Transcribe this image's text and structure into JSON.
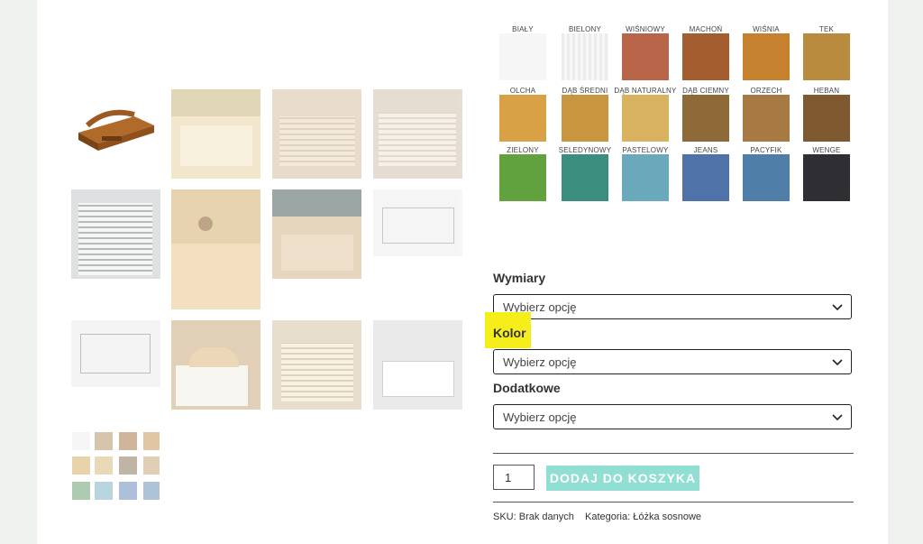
{
  "swatches": [
    {
      "label": "BIAŁY",
      "color": "#f4f4f4"
    },
    {
      "label": "BIELONY",
      "color": "#ebeceb"
    },
    {
      "label": "WIŚNIOWY",
      "color": "#b8654a"
    },
    {
      "label": "MACHOŃ",
      "color": "#a45d2e"
    },
    {
      "label": "WIŚNIA",
      "color": "#c6812e"
    },
    {
      "label": "TEK",
      "color": "#b88b3f"
    },
    {
      "label": "OLCHA",
      "color": "#d9a146"
    },
    {
      "label": "DĄB ŚREDNI",
      "color": "#c7963f"
    },
    {
      "label": "DĄB NATURALNY",
      "color": "#d8b25e"
    },
    {
      "label": "DĄB CIEMNY",
      "color": "#8f6a39"
    },
    {
      "label": "ORZECH",
      "color": "#a77a44"
    },
    {
      "label": "HEBAN",
      "color": "#7f5a31"
    },
    {
      "label": "ZIELONY",
      "color": "#62a23e"
    },
    {
      "label": "SELEDYNOWY",
      "color": "#3b8e7e"
    },
    {
      "label": "PASTELOWY",
      "color": "#6aa9bb"
    },
    {
      "label": "JEANS",
      "color": "#4f72a8"
    },
    {
      "label": "PACYFIK",
      "color": "#4f7ea8"
    },
    {
      "label": "WENGE",
      "color": "#2f2f33"
    }
  ],
  "form": {
    "dimensions_label": "Wymiary",
    "color_label": "Kolor",
    "extras_label": "Dodatkowe",
    "select_placeholder": "Wybierz opcję",
    "quantity": "1",
    "add_to_cart": "DODAJ DO KOSZYKA"
  },
  "meta": {
    "sku_label": "SKU:",
    "sku_value": "Brak danych",
    "category_label": "Kategoria:",
    "category_value": "Łóżka sosnowe"
  },
  "colors": {
    "accent_button": "#91ded3",
    "highlight": "#f5ee1a"
  }
}
